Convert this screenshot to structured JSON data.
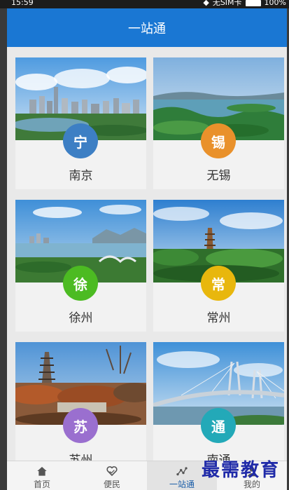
{
  "status": {
    "time": "15:59",
    "sim": "无SIM卡",
    "battery": "100%"
  },
  "header": {
    "title": "一站通"
  },
  "cities": [
    {
      "name": "南京",
      "badge": "宁",
      "color": "#3d7fc4"
    },
    {
      "name": "无锡",
      "badge": "锡",
      "color": "#e9912b"
    },
    {
      "name": "徐州",
      "badge": "徐",
      "color": "#4cbb22"
    },
    {
      "name": "常州",
      "badge": "常",
      "color": "#e8b70d"
    },
    {
      "name": "苏州",
      "badge": "苏",
      "color": "#9a6fcf"
    },
    {
      "name": "南通",
      "badge": "通",
      "color": "#23a9b8"
    }
  ],
  "tabs": [
    {
      "label": "首页",
      "icon": "home-icon"
    },
    {
      "label": "便民",
      "icon": "heart-handshake-icon"
    },
    {
      "label": "一站通",
      "icon": "route-icon"
    },
    {
      "label": "我的",
      "icon": "person-icon"
    }
  ],
  "active_tab": "一站通",
  "watermark": "最需教育",
  "accent_color": "#1a77d3"
}
